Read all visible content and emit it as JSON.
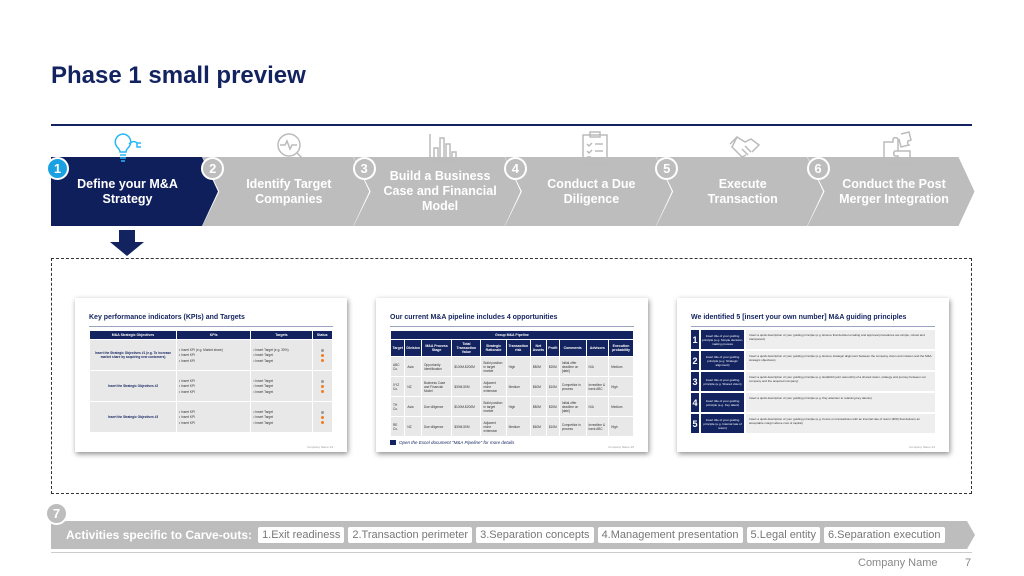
{
  "title": "Phase 1 small preview",
  "steps": [
    {
      "num": "1",
      "label": "Define your M&A Strategy",
      "icon": "lightbulb-icon",
      "active": true
    },
    {
      "num": "2",
      "label": "Identify Target Companies",
      "icon": "magnifier-pulse-icon"
    },
    {
      "num": "3",
      "label": "Build a Business Case and Financial Model",
      "icon": "bar-chart-icon"
    },
    {
      "num": "4",
      "label": "Conduct a Due Diligence",
      "icon": "clipboard-checklist-icon"
    },
    {
      "num": "5",
      "label": "Execute Transaction",
      "icon": "handshake-icon"
    },
    {
      "num": "6",
      "label": "Conduct the Post Merger Integration",
      "icon": "puzzle-icon"
    }
  ],
  "colors": {
    "navy": "#13235f",
    "active": "#1ba1e2",
    "inactive": "#bdbdbd",
    "orange": "#f07c22"
  },
  "previews": {
    "kpi": {
      "title": "Key performance indicators (KPIs) and Targets",
      "headers": [
        "M&A Strategic Objectives",
        "KPIs",
        "Targets",
        "Status"
      ],
      "rows": [
        {
          "obj": "Insert the Strategic Objectives #1 (e.g. To increase market share by acquiring new customers)",
          "kpis": [
            "• Insert KPI (e.g. Market share)",
            "• Insert KPI",
            "• Insert KPI"
          ],
          "targets": [
            "• Insert Target (e.g. 30%)",
            "• Insert Target",
            "• Insert Target"
          ]
        },
        {
          "obj": "Insert the Strategic Objectives #2",
          "kpis": [
            "• Insert KPI",
            "• Insert KPI",
            "• Insert KPI"
          ],
          "targets": [
            "• Insert Target",
            "• Insert Target",
            "• Insert Target"
          ]
        },
        {
          "obj": "Insert the Strategic Objectives #3",
          "kpis": [
            "• Insert KPI",
            "• Insert KPI",
            "• Insert KPI"
          ],
          "targets": [
            "• Insert Target",
            "• Insert Target",
            "• Insert Target"
          ]
        }
      ],
      "footer": "Company Name   23"
    },
    "pipeline": {
      "title": "Our current M&A pipeline includes 4 opportunities",
      "group": "Group M&A Pipeline",
      "headers": [
        "Target",
        "Division",
        "M&A Process Stage",
        "Total Transaction Value",
        "Strategic Rationale",
        "Transaction risk",
        "Net Assets",
        "Profit",
        "Comments",
        "Advisors",
        "Execution probability"
      ],
      "rows": [
        [
          "ABC Co.",
          "Asia",
          "Opportunity Identification",
          "$100M-$200M",
          "Build position in target market",
          "High",
          "$80M",
          "$20M",
          "Initial offer deadline on [date]",
          "N/A",
          "Medium"
        ],
        [
          "XYZ Co.",
          "NZ",
          "Business Case and Financial Model",
          "$30M-50M",
          "Adjacent niche extension",
          "Medium",
          "$60M",
          "$10M",
          "Competitor in process",
          "Investline & bank ABC",
          "High"
        ],
        [
          "TH Co.",
          "Asia",
          "Due diligence",
          "$100M-$200M",
          "Build position in target market",
          "High",
          "$80M",
          "$20M",
          "Initial offer deadline on [date]",
          "N/A",
          "Medium"
        ],
        [
          "RE Co.",
          "NZ",
          "Due diligence",
          "$30M-50M",
          "Adjacent niche extension",
          "Medium",
          "$60M",
          "$10M",
          "Competitor in process",
          "Investline & bank ABC",
          "High"
        ]
      ],
      "note": "Open the Excel document \"M&A Pipeline\" for more details",
      "footer": "Company Name   25"
    },
    "principles": {
      "title": "We identified 5 [insert your own number] M&A guiding principles",
      "items": [
        {
          "n": "1",
          "t": "Insert title of your guiding principle (e.g. Simple decision-making process",
          "d": "Insert a quick description of your guiding principle (e.g. Ensure that decision-making and approval procedures are simple, robust and transparent)"
        },
        {
          "n": "2",
          "t": "Insert title of your guiding principle (e.g. Strategic alignment)",
          "d": "Insert a quick description of your guiding principle (e.g. Ensure strategic alignment between the company vision and mission and the M&A strategic objectives)"
        },
        {
          "n": "3",
          "t": "Insert title of your guiding principle (e.g. Shared vision)",
          "d": "Insert a quick description of your guiding principle (e.g. Establish joint ownership of a shared vision, strategy and journey between our company and the acquired company)"
        },
        {
          "n": "4",
          "t": "Insert title of your guiding principle (e.g. Key talent)",
          "d": "Insert a quick description of your guiding principle (e.g. Pay attention to retaining key talents)"
        },
        {
          "n": "5",
          "t": "Insert title of your guiding principle (e.g. Internal rate of return)",
          "d": "Insert a quick description of your guiding principle (e.g. Focus on transactions with an internal rate of return (IRR) that delivers an acceptable margin above cost of capital)"
        }
      ],
      "footer": "Company Name   24"
    }
  },
  "carveouts": {
    "num": "7",
    "label": "Activities specific to Carve-outs:",
    "items": [
      "1.Exit readiness",
      "2.Transaction perimeter",
      "3.Separation concepts",
      "4.Management presentation",
      "5.Legal entity",
      "6.Separation execution"
    ]
  },
  "footer": {
    "company": "Company Name",
    "page": "7"
  }
}
